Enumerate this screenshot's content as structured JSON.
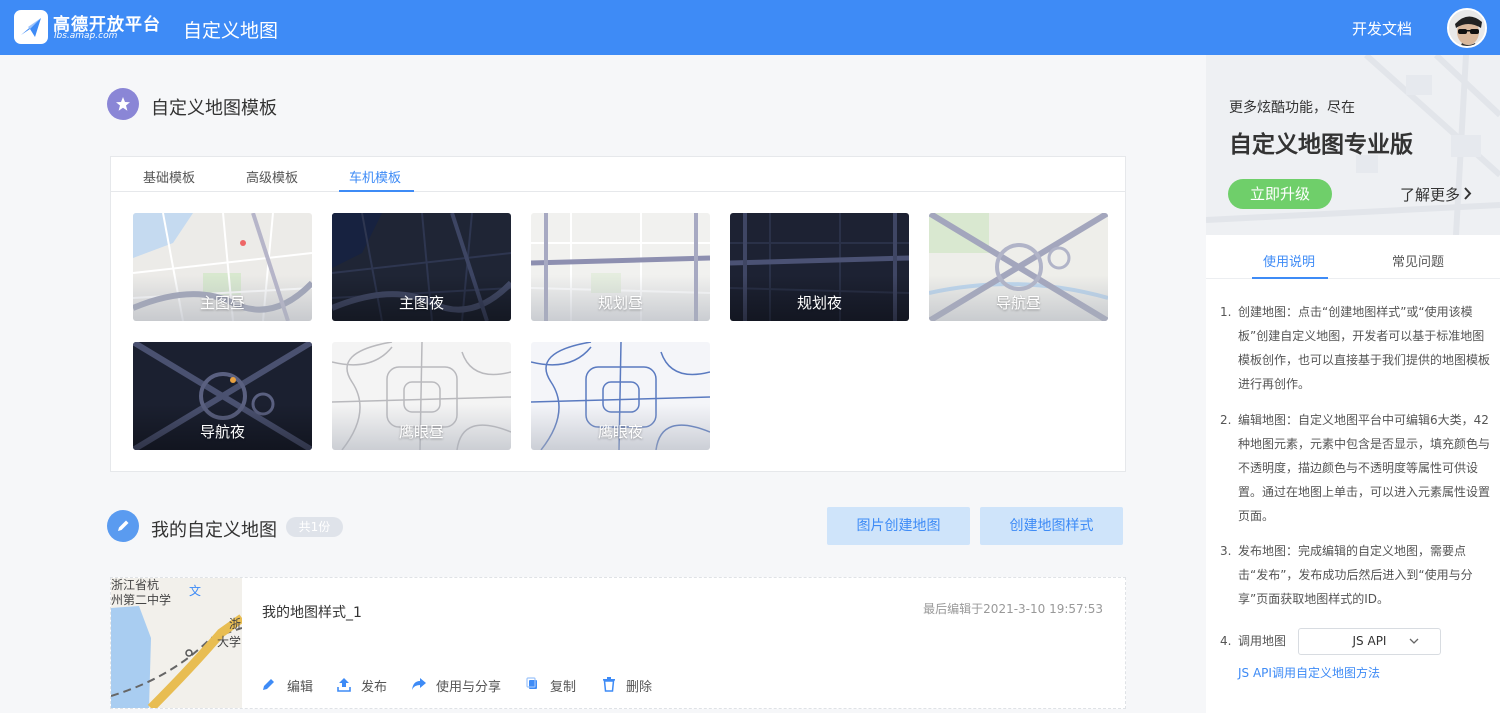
{
  "header": {
    "brand_name": "高德开放平台",
    "brand_sub": "lbs.amap.com",
    "app_title": "自定义地图",
    "docs_link": "开发文档"
  },
  "templates": {
    "title": "自定义地图模板",
    "tabs": [
      "基础模板",
      "高级模板",
      "车机模板"
    ],
    "active_tab": "车机模板",
    "cards": [
      {
        "label": "主图昼",
        "theme": "light"
      },
      {
        "label": "主图夜",
        "theme": "dark"
      },
      {
        "label": "规划昼",
        "theme": "light"
      },
      {
        "label": "规划夜",
        "theme": "dark"
      },
      {
        "label": "导航昼",
        "theme": "light"
      },
      {
        "label": "导航夜",
        "theme": "dark"
      },
      {
        "label": "鹰眼昼",
        "theme": "light"
      },
      {
        "label": "鹰眼夜",
        "theme": "light"
      }
    ]
  },
  "my_maps": {
    "title": "我的自定义地图",
    "count_badge": "共1份",
    "btn_image_create": "图片创建地图",
    "btn_style_create": "创建地图样式",
    "items": [
      {
        "name": "我的地图样式_1",
        "last_edited": "最后编辑于2021-3-10 19:57:53",
        "thumb_text": [
          "浙江省杭",
          "州第二中学",
          "文",
          "浙",
          "大学"
        ],
        "actions": [
          "编辑",
          "发布",
          "使用与分享",
          "复制",
          "删除"
        ]
      }
    ]
  },
  "sidebar": {
    "promo_sub": "更多炫酷功能，尽在",
    "promo_title": "自定义地图专业版",
    "upgrade_button": "立即升级",
    "learn_more": "了解更多",
    "tabs": [
      "使用说明",
      "常见问题"
    ],
    "active_tab": "使用说明",
    "instructions": [
      {
        "num": "1.",
        "text": "创建地图：点击“创建地图样式”或“使用该模板”创建自定义地图，开发者可以基于标准地图模板创作，也可以直接基于我们提供的地图模板进行再创作。"
      },
      {
        "num": "2.",
        "text": "编辑地图：自定义地图平台中可编辑6大类，42种地图元素，元素中包含是否显示，填充颜色与不透明度，描边颜色与不透明度等属性可供设置。通过在地图上单击，可以进入元素属性设置页面。"
      },
      {
        "num": "3.",
        "text": "发布地图：完成编辑的自定义地图，需要点击“发布”，发布成功后然后进入到“使用与分享”页面获取地图样式的ID。"
      },
      {
        "num": "4.",
        "text": "调用地图"
      }
    ],
    "api_select": "JS API",
    "api_link": "JS API调用自定义地图方法"
  }
}
